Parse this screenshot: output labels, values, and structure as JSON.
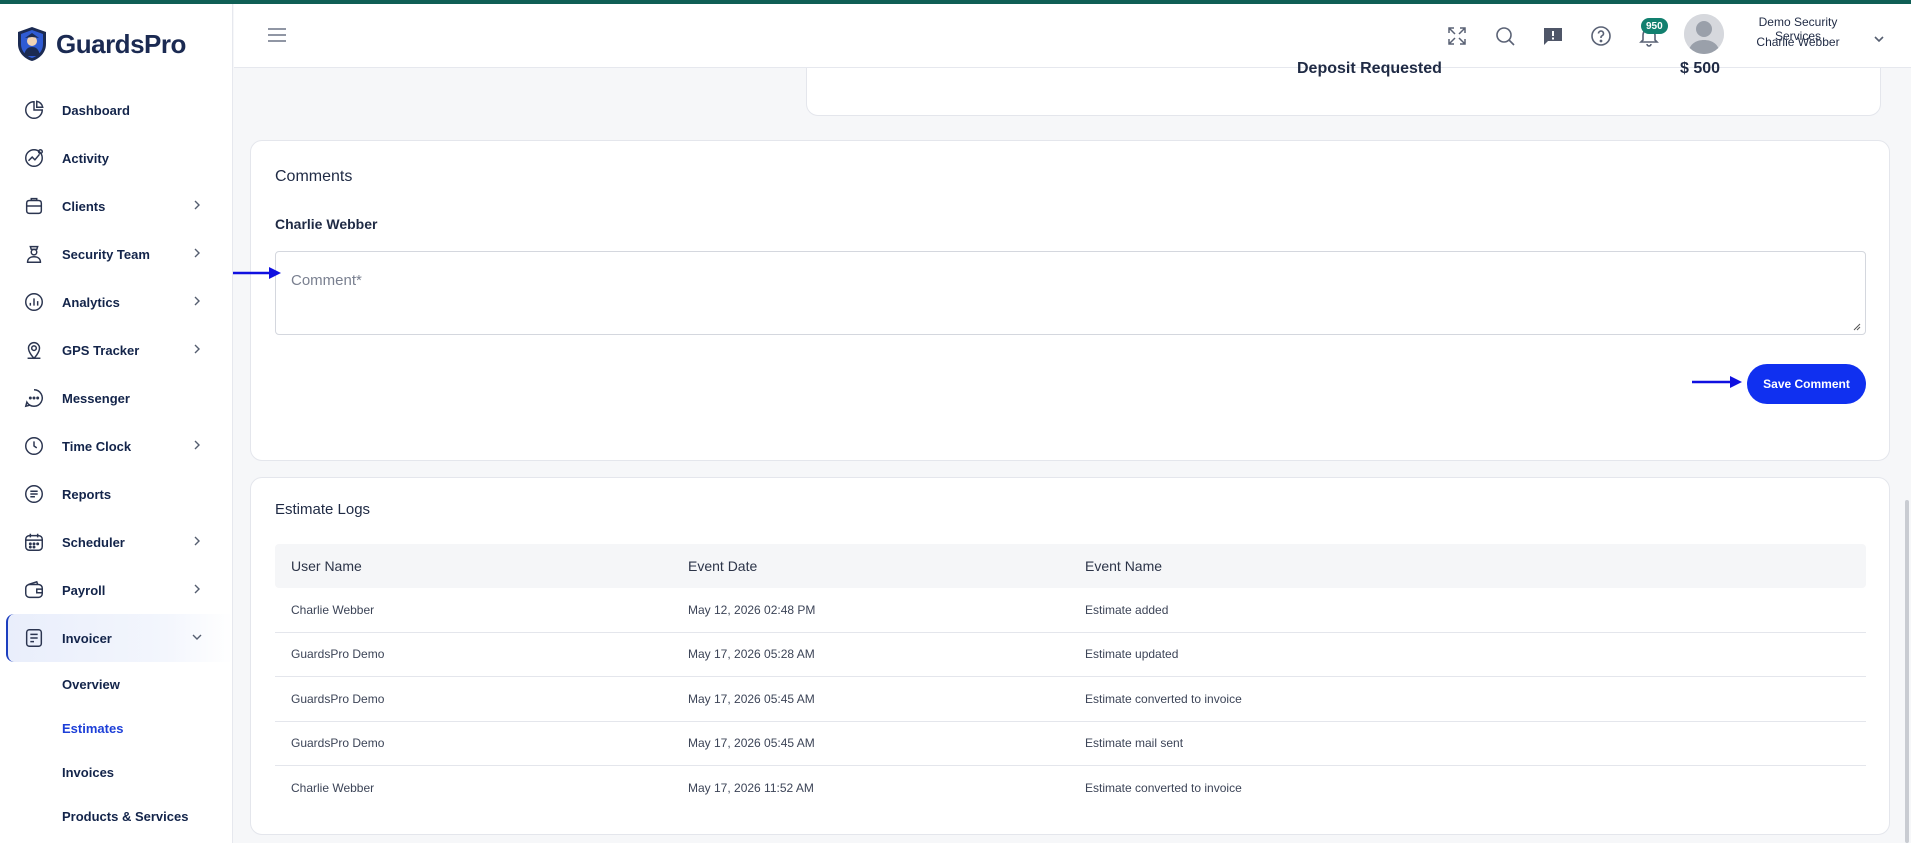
{
  "brand": {
    "name": "GuardsPro"
  },
  "sidebar": {
    "items": [
      {
        "label": "Dashboard",
        "icon": "dashboard-pie-icon",
        "chevron": false
      },
      {
        "label": "Activity",
        "icon": "activity-chart-icon",
        "chevron": false
      },
      {
        "label": "Clients",
        "icon": "briefcase-icon",
        "chevron": true
      },
      {
        "label": "Security Team",
        "icon": "guard-person-icon",
        "chevron": true
      },
      {
        "label": "Analytics",
        "icon": "analytics-bars-icon",
        "chevron": true
      },
      {
        "label": "GPS Tracker",
        "icon": "location-pin-icon",
        "chevron": true
      },
      {
        "label": "Messenger",
        "icon": "chat-bubble-icon",
        "chevron": false
      },
      {
        "label": "Time Clock",
        "icon": "clock-icon",
        "chevron": true
      },
      {
        "label": "Reports",
        "icon": "report-document-icon",
        "chevron": false
      },
      {
        "label": "Scheduler",
        "icon": "calendar-icon",
        "chevron": true
      },
      {
        "label": "Payroll",
        "icon": "wallet-icon",
        "chevron": true
      },
      {
        "label": "Invoicer",
        "icon": "invoice-icon",
        "chevron": true,
        "expanded": true
      }
    ],
    "invoicer_sub": [
      {
        "label": "Overview"
      },
      {
        "label": "Estimates",
        "active": true
      },
      {
        "label": "Invoices"
      },
      {
        "label": "Products & Services"
      }
    ]
  },
  "header": {
    "notification_count": "950",
    "company": "Demo Security Services",
    "user": "Charlie Webber"
  },
  "deposit": {
    "label": "Deposit Requested",
    "value": "$ 500"
  },
  "comments": {
    "title": "Comments",
    "user": "Charlie Webber",
    "placeholder": "Comment*",
    "save_label": "Save Comment"
  },
  "logs": {
    "title": "Estimate Logs",
    "columns": [
      "User Name",
      "Event Date",
      "Event Name"
    ],
    "rows": [
      [
        "Charlie Webber",
        "May 12, 2026 02:48 PM",
        "Estimate added"
      ],
      [
        "GuardsPro Demo",
        "May 17, 2026 05:28 AM",
        "Estimate updated"
      ],
      [
        "GuardsPro Demo",
        "May 17, 2026 05:45 AM",
        "Estimate converted to invoice"
      ],
      [
        "GuardsPro Demo",
        "May 17, 2026 05:45 AM",
        "Estimate mail sent"
      ],
      [
        "Charlie Webber",
        "May 17, 2026 11:52 AM",
        "Estimate converted to invoice"
      ]
    ]
  },
  "colors": {
    "primary": "#1030f0",
    "brand_dark": "#1b2a52",
    "badge": "#12806f",
    "top_line": "#0f5f55",
    "annotation_arrow": "#1010e0"
  }
}
